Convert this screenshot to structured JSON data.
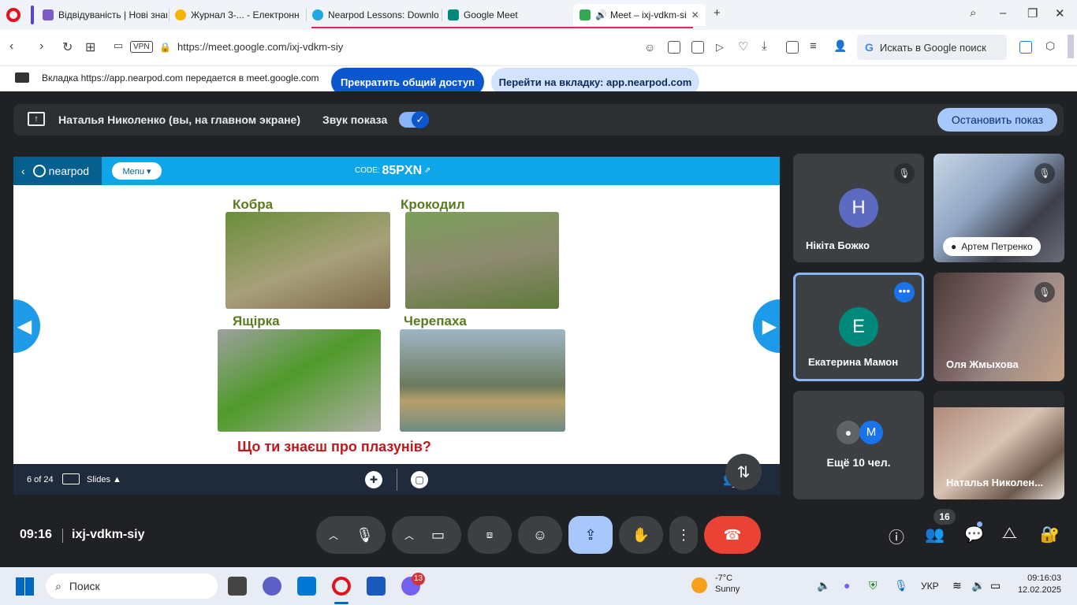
{
  "browser": {
    "tabs": [
      {
        "title": "Відвідуваність | Нові знан",
        "color": "#7a5cc4"
      },
      {
        "title": "Журнал 3-... - Електронні",
        "color": "#f5b400"
      },
      {
        "title": "Nearpod Lessons: Downlo",
        "color": "#1ea7e0"
      },
      {
        "title": "Google Meet",
        "color": "#00897b"
      },
      {
        "title": "Meet – ixj-vdkm-si",
        "color": "#34a853"
      }
    ],
    "url": "https://meet.google.com/ixj-vdkm-siy",
    "vpn": "VPN",
    "search_placeholder": "Искать в Google поиск",
    "search_g": "G"
  },
  "share_info": {
    "text": "Вкладка https://app.nearpod.com передается в meet.google.com",
    "stop_label": "Прекратить общий доступ",
    "goto_label": "Перейти на вкладку: app.nearpod.com"
  },
  "meet": {
    "presenter": "Наталья Николенко (вы, на главном экране)",
    "sound_label": "Звук показа",
    "stop_show": "Остановить показ",
    "time": "09:16",
    "code": "ixj-vdkm-siy",
    "participants_count": "16"
  },
  "nearpod": {
    "logo": "nearpod",
    "menu": "Menu ▾",
    "code_label": "CODE:",
    "code": "85PXN",
    "slide_counter": "6 of 24",
    "slides_label": "Slides ▲",
    "badge_10": "10",
    "slide": {
      "labels": [
        "Кобра",
        "Крокодил",
        "Ящірка",
        "Черепаха"
      ],
      "question": "Що ти знаєш про плазунів?"
    }
  },
  "participants": [
    {
      "name": "Нікіта Божко",
      "initial": "H",
      "color": "#5c6bc0",
      "muted": true
    },
    {
      "name": "Артем Петренко",
      "video": true,
      "muted": true
    },
    {
      "name": "Екатерина Мамон",
      "initial": "E",
      "color": "#00897b",
      "active": true
    },
    {
      "name": "Оля Жмыхова",
      "video": true,
      "muted": true
    },
    {
      "name": "Ещё 10 чел.",
      "initial": "M",
      "color": "#1a73e8"
    },
    {
      "name": "Наталья Николен...",
      "video": true
    }
  ],
  "taskbar": {
    "search": "Поиск",
    "temp": "-7°C",
    "weather": "Sunny",
    "lang": "УКР",
    "time": "09:16:03",
    "date": "12.02.2025",
    "viber_badge": "13"
  }
}
